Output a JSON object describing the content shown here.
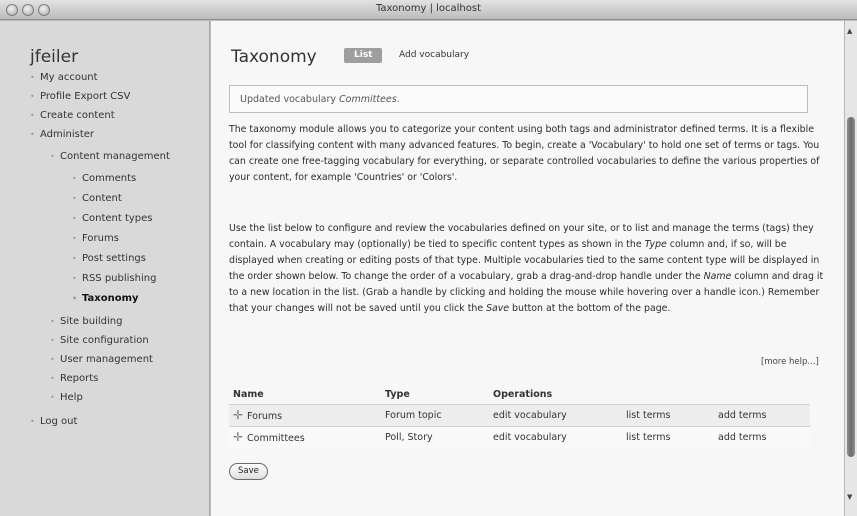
{
  "window": {
    "title": "Taxonomy | localhost"
  },
  "sidebar": {
    "username": "jfeiler",
    "items": [
      {
        "label": "My account",
        "depth": 1
      },
      {
        "label": "Profile Export CSV",
        "depth": 1
      },
      {
        "label": "Create content",
        "depth": 1
      },
      {
        "label": "Administer",
        "depth": 1
      },
      {
        "label": "Content management",
        "depth": 2
      },
      {
        "label": "Comments",
        "depth": 3
      },
      {
        "label": "Content",
        "depth": 3
      },
      {
        "label": "Content types",
        "depth": 3
      },
      {
        "label": "Forums",
        "depth": 3
      },
      {
        "label": "Post settings",
        "depth": 3
      },
      {
        "label": "RSS publishing",
        "depth": 3
      },
      {
        "label": "Taxonomy",
        "depth": 3,
        "active": true
      },
      {
        "label": "Site building",
        "depth": 2
      },
      {
        "label": "Site configuration",
        "depth": 2
      },
      {
        "label": "User management",
        "depth": 2
      },
      {
        "label": "Reports",
        "depth": 2
      },
      {
        "label": "Help",
        "depth": 2
      },
      {
        "label": "Log out",
        "depth": 1
      }
    ]
  },
  "main": {
    "title": "Taxonomy",
    "tabs": {
      "list": "List",
      "add": "Add vocabulary"
    },
    "status": {
      "prefix": "Updated vocabulary ",
      "name": "Committees",
      "suffix": "."
    },
    "para1": "The taxonomy module allows you to categorize your content using both tags and administrator defined terms. It is a flexible tool for classifying content with many advanced features. To begin, create a 'Vocabulary' to hold one set of terms or tags. You can create one free-tagging vocabulary for everything, or separate controlled vocabularies to define the various properties of your content, for example 'Countries' or 'Colors'.",
    "para2": {
      "a": "Use the list below to configure and review the vocabularies defined on your site, or to list and manage the terms (tags) they contain. A vocabulary may (optionally) be tied to specific content types as shown in the ",
      "type_em": "Type",
      "b": " column and, if so, will be displayed when creating or editing posts of that type. Multiple vocabularies tied to the same content type will be displayed in the order shown below. To change the order of a vocabulary, grab a drag-and-drop handle under the ",
      "name_em": "Name",
      "c": " column and drag it to a new location in the list. (Grab a handle by clicking and holding the mouse while hovering over a handle icon.) Remember that your changes will not be saved until you click the ",
      "save_em": "Save",
      "d": " button at the bottom of the page."
    },
    "more_help": "[more help...]",
    "table": {
      "headers": {
        "name": "Name",
        "type": "Type",
        "operations": "Operations"
      },
      "rows": [
        {
          "name": "Forums",
          "type": "Forum topic",
          "edit": "edit vocabulary",
          "list": "list terms",
          "add": "add terms"
        },
        {
          "name": "Committees",
          "type": "Poll, Story",
          "edit": "edit vocabulary",
          "list": "list terms",
          "add": "add terms"
        }
      ]
    },
    "save_label": "Save"
  }
}
